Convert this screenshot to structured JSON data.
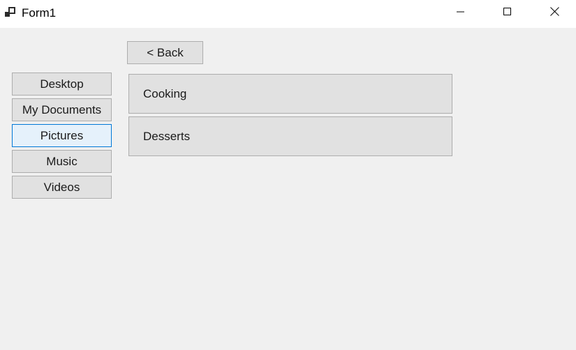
{
  "window": {
    "title": "Form1",
    "controls": {
      "minimize_icon": "minimize-icon",
      "maximize_icon": "maximize-icon",
      "close_icon": "close-icon"
    }
  },
  "toolbar": {
    "back_label": "< Back"
  },
  "sidebar": {
    "items": [
      {
        "label": "Desktop",
        "selected": false
      },
      {
        "label": "My Documents",
        "selected": false
      },
      {
        "label": "Pictures",
        "selected": true
      },
      {
        "label": "Music",
        "selected": false
      },
      {
        "label": "Videos",
        "selected": false
      }
    ]
  },
  "content": {
    "folders": [
      {
        "label": "Cooking"
      },
      {
        "label": "Desserts"
      }
    ]
  },
  "colors": {
    "background": "#f0f0f0",
    "button_face": "#e1e1e1",
    "button_border": "#adadad",
    "selected_face": "#e5f1fb",
    "selected_border": "#0078d7"
  }
}
